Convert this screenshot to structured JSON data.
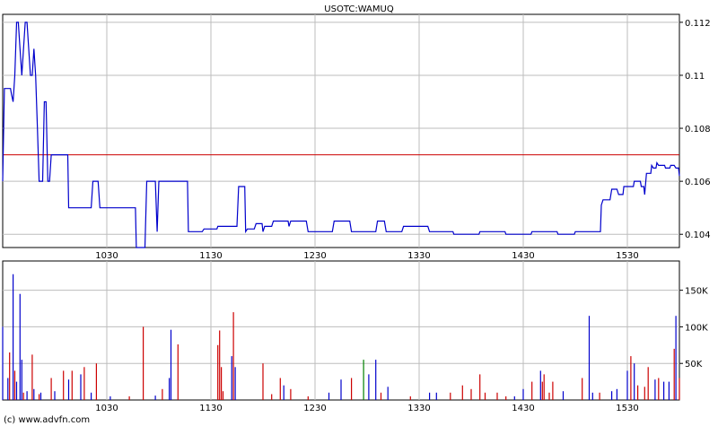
{
  "colors": {
    "price_line": "#0000cc",
    "ref_line": "#cc0000",
    "grid": "#bdbdbd",
    "axis": "#000000",
    "vol_up": "#0000cc",
    "vol_down": "#cc0000",
    "vol_neutral": "#008000"
  },
  "footer": "(c) www.advfn.com",
  "chart_data": [
    {
      "type": "line",
      "title": "USOTC:WAMUQ",
      "x_ticks": [
        "1030",
        "1130",
        "1230",
        "1330",
        "1430",
        "1530"
      ],
      "y_ticks": [
        "0.112",
        "0.11",
        "0.108",
        "0.106",
        "0.104"
      ],
      "xlim": [
        "09:30",
        "16:00"
      ],
      "ylim": [
        0.1035,
        0.1123
      ],
      "reference_line": 0.107,
      "grid": true,
      "series": [
        {
          "x": [
            "09:30",
            "09:31",
            "09:32",
            "09:35",
            "09:36",
            "09:37",
            "09:38",
            "09:39",
            "09:40",
            "09:41",
            "09:42",
            "09:43",
            "09:44",
            "09:45",
            "09:46",
            "09:47",
            "09:48",
            "09:49",
            "09:50",
            "09:51",
            "09:53",
            "09:54",
            "09:55",
            "09:56",
            "09:57",
            "09:58",
            "10:02",
            "10:05",
            "10:08",
            "10:15",
            "10:21",
            "10:22",
            "10:25",
            "10:26",
            "10:47",
            "10:48",
            "10:52",
            "10:53",
            "10:58",
            "10:59",
            "11:00",
            "11:01",
            "11:10",
            "11:17",
            "11:25",
            "11:26",
            "11:30",
            "11:34",
            "11:45",
            "11:46",
            "11:50",
            "11:51",
            "11:55",
            "11:56",
            "12:00",
            "12:01",
            "12:05",
            "12:06",
            "12:10",
            "12:15",
            "12:16",
            "12:25",
            "12:26",
            "12:30",
            "12:40",
            "12:41",
            "12:50",
            "12:51",
            "13:00",
            "13:05",
            "13:06",
            "13:10",
            "13:11",
            "13:20",
            "13:21",
            "13:35",
            "13:36",
            "13:40",
            "13:50",
            "14:00",
            "14:05",
            "14:20",
            "14:30",
            "14:35",
            "14:42",
            "14:50",
            "15:00",
            "15:06",
            "15:10",
            "15:15",
            "15:16",
            "15:20",
            "15:21",
            "15:24",
            "15:25",
            "15:28",
            "15:29",
            "15:34",
            "15:35",
            "15:38",
            "15:40",
            "15:41",
            "15:44",
            "15:45",
            "15:47",
            "15:48",
            "15:52",
            "15:55",
            "15:57",
            "15:58",
            "16:00"
          ],
          "y": [
            0.106,
            0.1095,
            0.1095,
            0.1093,
            0.109,
            0.11,
            0.112,
            0.112,
            0.111,
            0.11,
            0.111,
            0.112,
            0.112,
            0.111,
            0.11,
            0.11,
            0.111,
            0.11,
            0.108,
            0.106,
            0.106,
            0.109,
            0.109,
            0.106,
            0.106,
            0.107,
            0.107,
            0.107,
            0.105,
            0.105,
            0.105,
            0.106,
            0.106,
            0.105,
            0.1035,
            0.1035,
            0.1035,
            0.106,
            0.106,
            0.1041,
            0.106,
            0.106,
            0.106,
            0.1041,
            0.1041,
            0.1042,
            0.1042,
            0.1043,
            0.1043,
            0.1058,
            0.1041,
            0.1042,
            0.1042,
            0.1044,
            0.1041,
            0.1043,
            0.1043,
            0.1045,
            0.1045,
            0.1043,
            0.1045,
            0.1045,
            0.1041,
            0.1041,
            0.1041,
            0.1045,
            0.1045,
            0.1041,
            0.1041,
            0.1041,
            0.1045,
            0.1045,
            0.1041,
            0.1041,
            0.1043,
            0.1043,
            0.1041,
            0.1041,
            0.104,
            0.104,
            0.1041,
            0.104,
            0.104,
            0.1041,
            0.1041,
            0.104,
            0.1041,
            0.1041,
            0.1041,
            0.1051,
            0.1053,
            0.1053,
            0.1057,
            0.1057,
            0.1055,
            0.1058,
            0.1058,
            0.106,
            0.106,
            0.1058,
            0.1055,
            0.1063,
            0.1066,
            0.1065,
            0.1067,
            0.1066,
            0.1065,
            0.1066,
            0.1066,
            0.1065,
            0.1062
          ]
        }
      ]
    },
    {
      "type": "bar",
      "y_ticks": [
        "150K",
        "100K",
        "50K"
      ],
      "x_ticks": [
        "1030",
        "1130",
        "1230",
        "1330",
        "1430",
        "1530"
      ],
      "xlim": [
        "09:30",
        "16:00"
      ],
      "ylim": [
        0,
        190000
      ],
      "grid": true,
      "bars": [
        {
          "t": "09:30",
          "v": 100000,
          "d": "up"
        },
        {
          "t": "09:33",
          "v": 30000,
          "d": "up"
        },
        {
          "t": "09:34",
          "v": 65000,
          "d": "down"
        },
        {
          "t": "09:36",
          "v": 172000,
          "d": "up"
        },
        {
          "t": "09:37",
          "v": 40000,
          "d": "down"
        },
        {
          "t": "09:38",
          "v": 25000,
          "d": "up"
        },
        {
          "t": "09:40",
          "v": 145000,
          "d": "up"
        },
        {
          "t": "09:41",
          "v": 55000,
          "d": "up"
        },
        {
          "t": "09:42",
          "v": 10000,
          "d": "down"
        },
        {
          "t": "09:44",
          "v": 12000,
          "d": "up"
        },
        {
          "t": "09:47",
          "v": 62000,
          "d": "down"
        },
        {
          "t": "09:48",
          "v": 15000,
          "d": "up"
        },
        {
          "t": "09:51",
          "v": 8000,
          "d": "down"
        },
        {
          "t": "09:52",
          "v": 10000,
          "d": "up"
        },
        {
          "t": "09:58",
          "v": 30000,
          "d": "down"
        },
        {
          "t": "10:00",
          "v": 12000,
          "d": "up"
        },
        {
          "t": "10:05",
          "v": 40000,
          "d": "down"
        },
        {
          "t": "10:08",
          "v": 28000,
          "d": "up"
        },
        {
          "t": "10:10",
          "v": 40000,
          "d": "down"
        },
        {
          "t": "10:15",
          "v": 35000,
          "d": "up"
        },
        {
          "t": "10:17",
          "v": 45000,
          "d": "down"
        },
        {
          "t": "10:21",
          "v": 10000,
          "d": "up"
        },
        {
          "t": "10:24",
          "v": 50000,
          "d": "down"
        },
        {
          "t": "10:32",
          "v": 5000,
          "d": "up"
        },
        {
          "t": "10:43",
          "v": 5000,
          "d": "down"
        },
        {
          "t": "10:51",
          "v": 100000,
          "d": "down"
        },
        {
          "t": "10:58",
          "v": 6000,
          "d": "up"
        },
        {
          "t": "11:02",
          "v": 15000,
          "d": "down"
        },
        {
          "t": "11:06",
          "v": 30000,
          "d": "up"
        },
        {
          "t": "11:07",
          "v": 96000,
          "d": "up"
        },
        {
          "t": "11:11",
          "v": 76000,
          "d": "down"
        },
        {
          "t": "11:34",
          "v": 75000,
          "d": "down"
        },
        {
          "t": "11:35",
          "v": 95000,
          "d": "down"
        },
        {
          "t": "11:36",
          "v": 45000,
          "d": "down"
        },
        {
          "t": "11:37",
          "v": 12000,
          "d": "down"
        },
        {
          "t": "11:42",
          "v": 60000,
          "d": "up"
        },
        {
          "t": "11:43",
          "v": 120000,
          "d": "down"
        },
        {
          "t": "11:44",
          "v": 45000,
          "d": "up"
        },
        {
          "t": "12:00",
          "v": 50000,
          "d": "down"
        },
        {
          "t": "12:05",
          "v": 8000,
          "d": "down"
        },
        {
          "t": "12:10",
          "v": 30000,
          "d": "down"
        },
        {
          "t": "12:12",
          "v": 20000,
          "d": "up"
        },
        {
          "t": "12:16",
          "v": 15000,
          "d": "down"
        },
        {
          "t": "12:26",
          "v": 5000,
          "d": "down"
        },
        {
          "t": "12:38",
          "v": 10000,
          "d": "up"
        },
        {
          "t": "12:45",
          "v": 28000,
          "d": "up"
        },
        {
          "t": "12:51",
          "v": 30000,
          "d": "down"
        },
        {
          "t": "12:58",
          "v": 55000,
          "d": "neutral"
        },
        {
          "t": "13:01",
          "v": 35000,
          "d": "up"
        },
        {
          "t": "13:05",
          "v": 55000,
          "d": "up"
        },
        {
          "t": "13:08",
          "v": 10000,
          "d": "down"
        },
        {
          "t": "13:12",
          "v": 18000,
          "d": "up"
        },
        {
          "t": "13:25",
          "v": 5000,
          "d": "down"
        },
        {
          "t": "13:36",
          "v": 10000,
          "d": "up"
        },
        {
          "t": "13:40",
          "v": 10000,
          "d": "up"
        },
        {
          "t": "13:48",
          "v": 10000,
          "d": "down"
        },
        {
          "t": "13:55",
          "v": 20000,
          "d": "down"
        },
        {
          "t": "14:00",
          "v": 15000,
          "d": "down"
        },
        {
          "t": "14:05",
          "v": 35000,
          "d": "down"
        },
        {
          "t": "14:08",
          "v": 10000,
          "d": "down"
        },
        {
          "t": "14:15",
          "v": 10000,
          "d": "down"
        },
        {
          "t": "14:20",
          "v": 5000,
          "d": "down"
        },
        {
          "t": "14:25",
          "v": 5000,
          "d": "up"
        },
        {
          "t": "14:30",
          "v": 15000,
          "d": "up"
        },
        {
          "t": "14:35",
          "v": 25000,
          "d": "down"
        },
        {
          "t": "14:40",
          "v": 40000,
          "d": "up"
        },
        {
          "t": "14:41",
          "v": 25000,
          "d": "down"
        },
        {
          "t": "14:42",
          "v": 35000,
          "d": "down"
        },
        {
          "t": "14:45",
          "v": 10000,
          "d": "down"
        },
        {
          "t": "14:47",
          "v": 25000,
          "d": "down"
        },
        {
          "t": "14:53",
          "v": 12000,
          "d": "up"
        },
        {
          "t": "15:04",
          "v": 30000,
          "d": "down"
        },
        {
          "t": "15:08",
          "v": 115000,
          "d": "up"
        },
        {
          "t": "15:10",
          "v": 10000,
          "d": "up"
        },
        {
          "t": "15:14",
          "v": 10000,
          "d": "down"
        },
        {
          "t": "15:21",
          "v": 12000,
          "d": "up"
        },
        {
          "t": "15:24",
          "v": 15000,
          "d": "up"
        },
        {
          "t": "15:30",
          "v": 40000,
          "d": "up"
        },
        {
          "t": "15:32",
          "v": 60000,
          "d": "down"
        },
        {
          "t": "15:34",
          "v": 50000,
          "d": "up"
        },
        {
          "t": "15:36",
          "v": 20000,
          "d": "down"
        },
        {
          "t": "15:40",
          "v": 18000,
          "d": "down"
        },
        {
          "t": "15:42",
          "v": 45000,
          "d": "down"
        },
        {
          "t": "15:46",
          "v": 28000,
          "d": "up"
        },
        {
          "t": "15:48",
          "v": 30000,
          "d": "down"
        },
        {
          "t": "15:51",
          "v": 25000,
          "d": "up"
        },
        {
          "t": "15:54",
          "v": 25000,
          "d": "up"
        },
        {
          "t": "15:57",
          "v": 70000,
          "d": "down"
        },
        {
          "t": "15:58",
          "v": 115000,
          "d": "up"
        },
        {
          "t": "16:00",
          "v": 30000,
          "d": "down"
        }
      ]
    }
  ]
}
